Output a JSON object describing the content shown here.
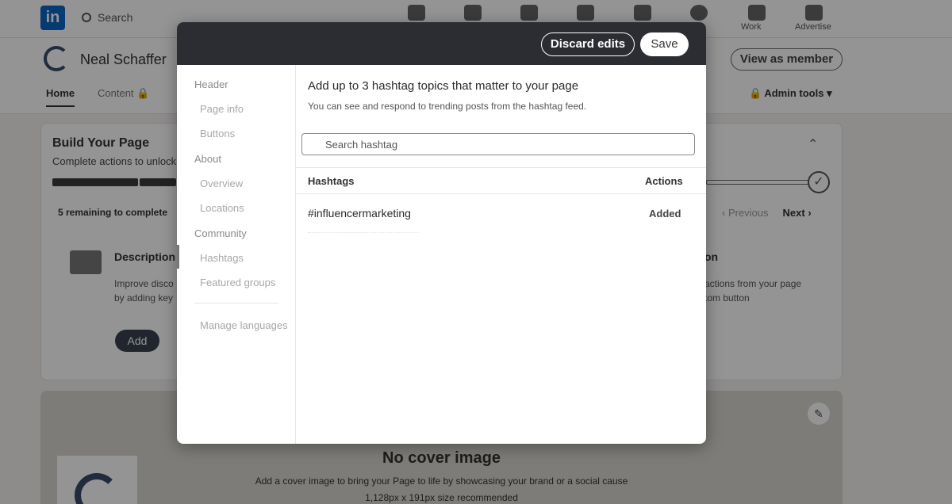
{
  "nav": {
    "search_placeholder": "Search",
    "work_label": "Work",
    "advertise_label": "Advertise"
  },
  "company": {
    "name": "Neal Schaffer",
    "view_as_member": "View as member",
    "tabs": {
      "home": "Home",
      "content": "Content"
    },
    "admin_tools": "Admin tools"
  },
  "build_page": {
    "title": "Build Your Page",
    "subtitle": "Complete actions to unlock",
    "remaining": "5 remaining to complete",
    "previous": "Previous",
    "next": "Next",
    "desc_title": "Description",
    "desc_text_1": "Improve disco",
    "desc_text_2": "by adding key",
    "add_label": "Add",
    "right_title": "on",
    "right_text_1": "actions from your page",
    "right_text_2": "tom button"
  },
  "cover": {
    "title": "No cover image",
    "subtitle": "Add a cover image to bring your Page to life by showcasing your brand or a social cause",
    "size_hint": "1,128px x 191px size recommended"
  },
  "modal": {
    "discard_label": "Discard edits",
    "save_label": "Save",
    "nav": {
      "header": "Header",
      "page_info": "Page info",
      "buttons": "Buttons",
      "about": "About",
      "overview": "Overview",
      "locations": "Locations",
      "community": "Community",
      "hashtags": "Hashtags",
      "featured_groups": "Featured groups",
      "manage_languages": "Manage languages"
    },
    "title": "Add up to 3 hashtag topics that matter to your page",
    "subtitle": "You can see and respond to trending posts from the hashtag feed.",
    "search_placeholder": "Search hashtag",
    "table": {
      "col_hashtags": "Hashtags",
      "col_actions": "Actions",
      "rows": [
        {
          "tag": "#influencermarketing",
          "status": "Added"
        }
      ]
    }
  }
}
